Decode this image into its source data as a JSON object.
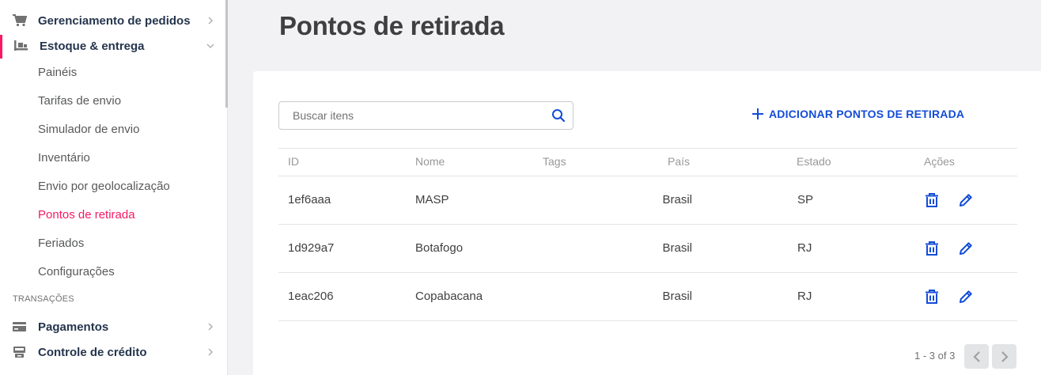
{
  "sidebar": {
    "items": [
      {
        "label": "Gerenciamento de pedidos",
        "icon": "cart-icon"
      },
      {
        "label": "Estoque & entrega",
        "icon": "truck-icon"
      }
    ],
    "submenu": [
      {
        "label": "Painéis"
      },
      {
        "label": "Tarifas de envio"
      },
      {
        "label": "Simulador de envio"
      },
      {
        "label": "Inventário"
      },
      {
        "label": "Envio por geolocalização"
      },
      {
        "label": "Pontos de retirada",
        "active": true
      },
      {
        "label": "Feriados"
      },
      {
        "label": "Configurações"
      }
    ],
    "section_title": "TRANSAÇÕES",
    "section_items": [
      {
        "label": "Pagamentos",
        "icon": "credit-card-icon"
      },
      {
        "label": "Controle de crédito",
        "icon": "register-icon"
      }
    ]
  },
  "main": {
    "title": "Pontos de retirada",
    "search": {
      "placeholder": "Buscar itens",
      "value": ""
    },
    "add_button_label": "ADICIONAR PONTOS DE RETIRADA",
    "table": {
      "headers": {
        "id": "ID",
        "name": "Nome",
        "tags": "Tags",
        "country": "País",
        "state": "Estado",
        "actions": "Ações"
      },
      "rows": [
        {
          "id": "1ef6aaa",
          "name": "MASP",
          "tags": "",
          "country": "Brasil",
          "state": "SP"
        },
        {
          "id": "1d929a7",
          "name": "Botafogo",
          "tags": "",
          "country": "Brasil",
          "state": "RJ"
        },
        {
          "id": "1eac206",
          "name": "Copabacana",
          "tags": "",
          "country": "Brasil",
          "state": "RJ"
        }
      ]
    },
    "pagination": {
      "text": "1 - 3 of 3"
    }
  },
  "colors": {
    "accent": "#f71963",
    "link": "#134cd8",
    "navy": "#25354d"
  }
}
